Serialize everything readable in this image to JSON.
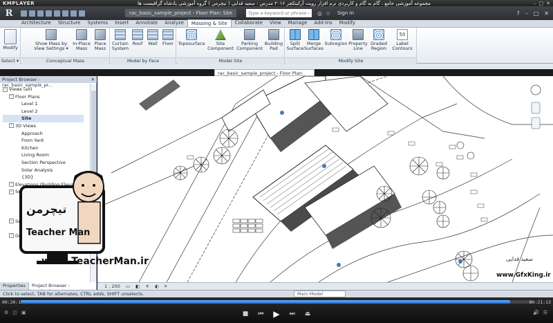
{
  "player": {
    "brand": "KMPLAYER",
    "title": "مجموعه آموزشی جامع ، گام به گام و کاربردی نرم افزار رویت آرکیتکچر ۲۰۱۶ مدرس : سعید فدایی ( تیچرمن ) گروه آموزشی پادشاه گرافیست ها",
    "time_current": "00:20:18",
    "time_total": "00:21:13",
    "progress": 0.957
  },
  "revit": {
    "app_letter": "R",
    "doc_title": "rac_basic_sample_project - Floor Plan: Site",
    "search_placeholder": "Type a keyword or phrase",
    "sign_in": "Sign In",
    "tabs": [
      "Architecture",
      "Structure",
      "Systems",
      "Insert",
      "Annotate",
      "Analyze",
      "Massing & Site",
      "Collaborate",
      "View",
      "Manage",
      "Add-Ins",
      "Modify"
    ],
    "active_tab": "Massing & Site",
    "ribbon": {
      "modify": "Modify",
      "select": "Select ▾",
      "conceptual_mass": {
        "label": "Conceptual Mass",
        "buttons": [
          "Show Mass by View Settings ▾",
          "In-Place Mass",
          "Place Mass"
        ]
      },
      "model_by_face": {
        "label": "Model by Face",
        "buttons": [
          "Curtain System",
          "Roof",
          "Wall",
          "Floor"
        ]
      },
      "model_site": {
        "label": "Model Site",
        "buttons": [
          "Toposurface",
          "Site Component",
          "Parking Component",
          "Building Pad"
        ]
      },
      "modify_site": {
        "label": "Modify Site",
        "buttons": [
          "Split Surface",
          "Merge Surfaces",
          "Subregion",
          "Property Line",
          "Graded Region",
          "Label Contours"
        ]
      }
    },
    "project_browser": {
      "header": "Project Browser - rac_basic_sample_pr...",
      "close": "✕",
      "tree": [
        {
          "indent": 0,
          "toggle": "−",
          "text": "Views (all)"
        },
        {
          "indent": 1,
          "toggle": "−",
          "text": "Floor Plans"
        },
        {
          "indent": 3,
          "toggle": "",
          "text": "Level 1"
        },
        {
          "indent": 3,
          "toggle": "",
          "text": "Level 2"
        },
        {
          "indent": 3,
          "toggle": "",
          "text": "Site",
          "selected": true
        },
        {
          "indent": 1,
          "toggle": "−",
          "text": "3D Views"
        },
        {
          "indent": 3,
          "toggle": "",
          "text": "Approach"
        },
        {
          "indent": 3,
          "toggle": "",
          "text": "From Yard"
        },
        {
          "indent": 3,
          "toggle": "",
          "text": "Kitchen"
        },
        {
          "indent": 3,
          "toggle": "",
          "text": "Living Room"
        },
        {
          "indent": 3,
          "toggle": "",
          "text": "Section Perspective"
        },
        {
          "indent": 3,
          "toggle": "",
          "text": "Solar Analysis"
        },
        {
          "indent": 3,
          "toggle": "",
          "text": "{3D}"
        },
        {
          "indent": 1,
          "toggle": "−",
          "text": "Elevations (Building Elevation)"
        },
        {
          "indent": 3,
          "toggle": "",
          "text": ""
        },
        {
          "indent": 3,
          "toggle": "",
          "text": ""
        },
        {
          "indent": 3,
          "toggle": "",
          "text": ""
        },
        {
          "indent": 1,
          "toggle": "−",
          "text": "Sections (Building Section)"
        },
        {
          "indent": 3,
          "toggle": "",
          "text": "B..."
        },
        {
          "indent": 3,
          "toggle": "",
          "text": "Longitudinal Section"
        },
        {
          "indent": 3,
          "toggle": "",
          "text": "Stair Section"
        },
        {
          "indent": 1,
          "toggle": "−",
          "text": "Sections (Wall Section)"
        },
        {
          "indent": 3,
          "toggle": "",
          "text": "Typ..."
        },
        {
          "indent": 1,
          "toggle": "−",
          "text": "Detail Views (Detail)"
        },
        {
          "indent": 3,
          "toggle": "",
          "text": "Main Stair Detail"
        }
      ],
      "bottom_tabs": [
        "Properties",
        "Project Browser - rac_basic..."
      ]
    },
    "view_controls": {
      "scale": "1 : 200"
    },
    "status": {
      "hint": "Click to select, TAB for alternates, CTRL adds, SHIFT unselects.",
      "model": "Main Model"
    }
  },
  "watermarks": {
    "teacherman_url": "www.TeacherMan.ir",
    "teacherman_name": "Teacher Man",
    "teacherman_fa": "تیچرمن",
    "gfxking_url": "www.GfxKing.ir",
    "gfxking_fa": "سعید فدایی"
  },
  "colors": {
    "accent": "#1a6cd6",
    "ribbon_bg": "#e6ebf1",
    "title_bg": "#2c2e32"
  }
}
